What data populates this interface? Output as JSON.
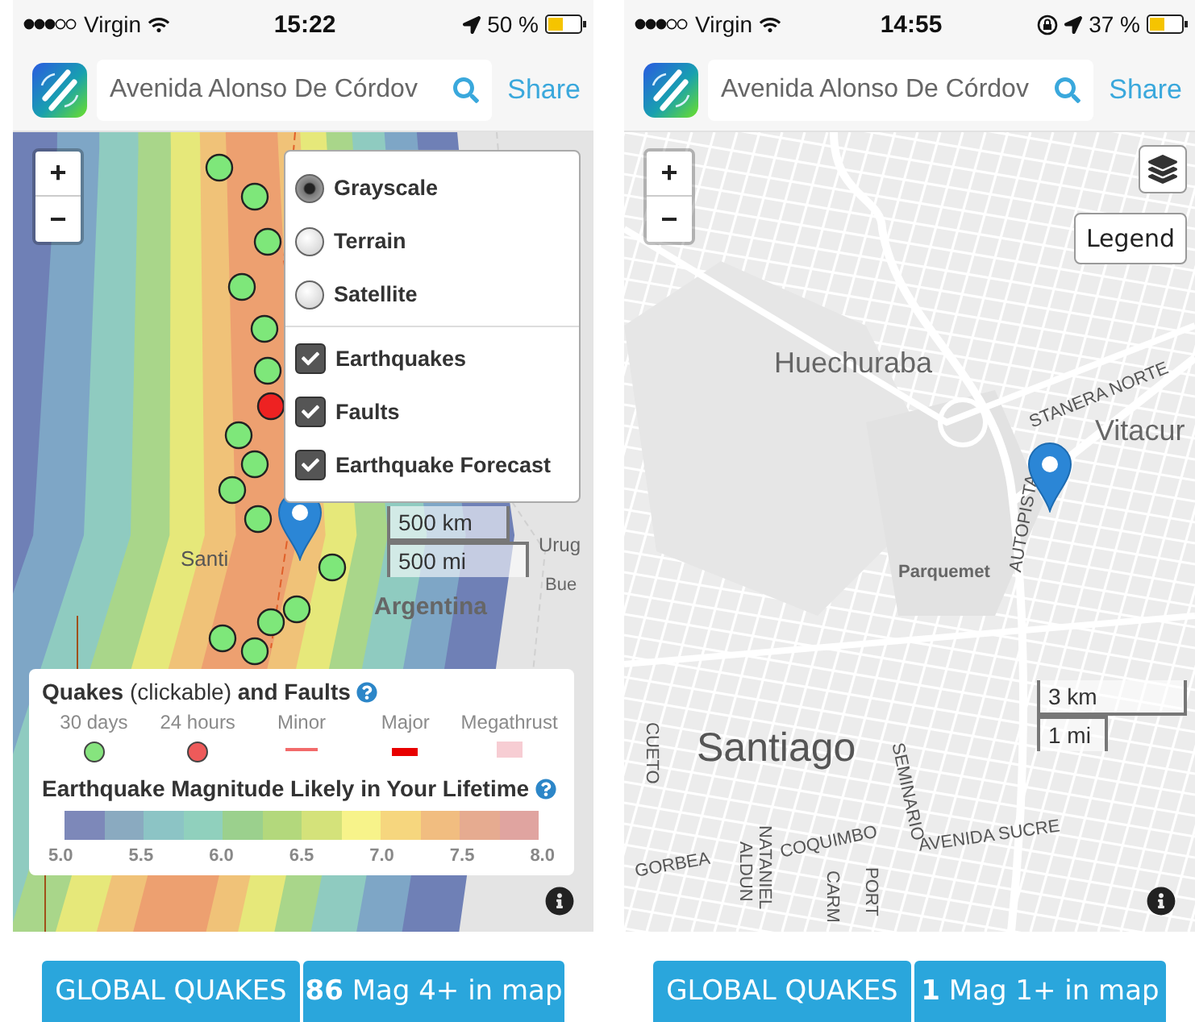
{
  "screens": [
    {
      "kind": "hazard",
      "status_bar": {
        "carrier": "Virgin",
        "time": "15:22",
        "battery": "50 %",
        "rotation_lock": false
      },
      "header": {
        "search": {
          "value": "Avenida Alonso De Córdov"
        },
        "share": "Share"
      },
      "map": {
        "zoom_in": "+",
        "zoom_out": "−",
        "labels": [
          "Santi",
          "Argentina",
          "Urug",
          "Bue"
        ],
        "layers_menu": {
          "base_layers": [
            {
              "label": "Grayscale",
              "selected": true
            },
            {
              "label": "Terrain",
              "selected": false
            },
            {
              "label": "Satellite",
              "selected": false
            }
          ],
          "overlays": [
            {
              "label": "Earthquakes",
              "checked": true
            },
            {
              "label": "Faults",
              "checked": true
            },
            {
              "label": "Earthquake Forecast",
              "checked": true
            }
          ]
        },
        "scale": [
          "500 km",
          "500 mi"
        ],
        "legend": {
          "quakes_title": "**Quakes** (clickable) **and Faults**",
          "symbols": [
            {
              "label": "30 days",
              "kind": "dot",
              "color": "#86e47e"
            },
            {
              "label": "24 hours",
              "kind": "dot",
              "color": "#ee5a5a"
            },
            {
              "label": "Minor",
              "kind": "thin-line",
              "color": "#f26a6a"
            },
            {
              "label": "Major",
              "kind": "thick-line",
              "color": "#e80000"
            },
            {
              "label": "Megathrust",
              "kind": "band",
              "color": "#f7cdd3"
            }
          ],
          "forecast_title": "Earthquake Magnitude Likely in Your Lifetime",
          "bands": [
            {
              "color": "#7d88b9"
            },
            {
              "color": "#8aaac0"
            },
            {
              "color": "#8cc4c5"
            },
            {
              "color": "#90d0bd"
            },
            {
              "color": "#9bd08d"
            },
            {
              "color": "#b3d87c"
            },
            {
              "color": "#d4e27a"
            },
            {
              "color": "#f7f38a"
            },
            {
              "color": "#f6d67e"
            },
            {
              "color": "#f1bd80"
            },
            {
              "color": "#e6ab90"
            },
            {
              "color": "#e0a4a0"
            }
          ],
          "ticks": [
            "5.0",
            "5.5",
            "6.0",
            "6.5",
            "7.0",
            "7.5",
            "8.0"
          ]
        }
      },
      "footer": {
        "global_button": "GLOBAL QUAKES",
        "count_button": "**86** Mag 4+ in map"
      }
    },
    {
      "kind": "street",
      "status_bar": {
        "carrier": "Virgin",
        "time": "14:55",
        "battery": "37 %",
        "rotation_lock": true
      },
      "header": {
        "search": {
          "value": "Avenida Alonso De Córdov"
        },
        "share": "Share"
      },
      "map": {
        "zoom_in": "+",
        "zoom_out": "−",
        "legend_button": "Legend",
        "labels": [
          "Huechuraba",
          "STANERA NORTE",
          "Vitacur",
          "AUTOPISTA",
          "Parquemet",
          "Santiago",
          "CUETO",
          "SEMINARIO",
          "AVENIDA SUCRE",
          "GORBEA",
          "NATANIEL",
          "ALDUN",
          "COQUIMBO",
          "CARM",
          "PORT"
        ],
        "scale": [
          "3 km",
          "1 mi"
        ]
      },
      "footer": {
        "global_button": "GLOBAL QUAKES",
        "count_button": "**1** Mag 1+ in map"
      }
    }
  ]
}
